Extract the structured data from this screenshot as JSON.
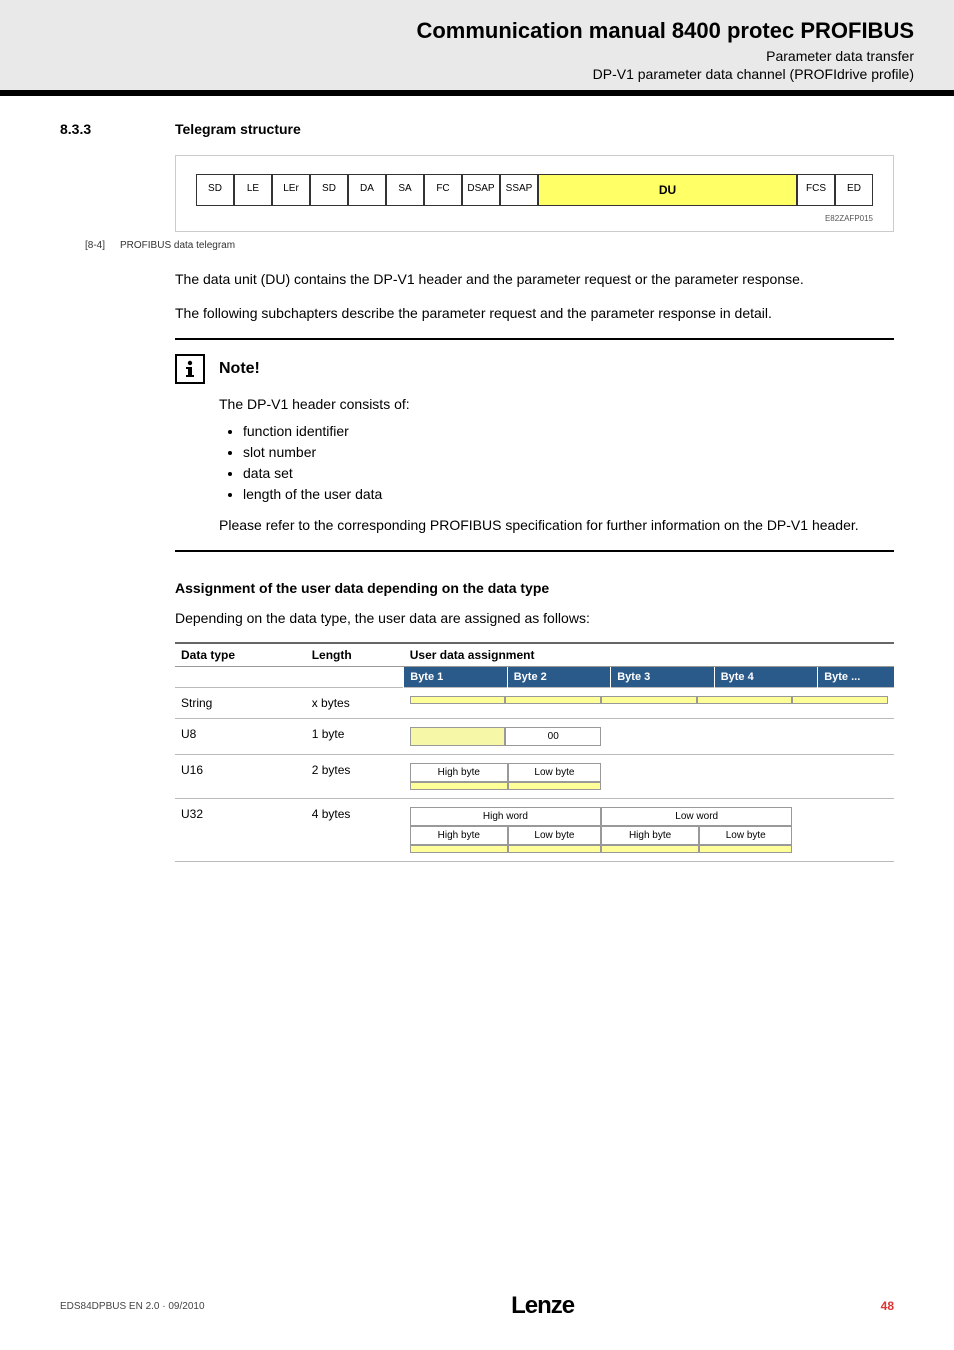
{
  "header": {
    "title": "Communication manual 8400 protec PROFIBUS",
    "sub1": "Parameter data transfer",
    "sub2": "DP-V1 parameter data channel (PROFIdrive profile)"
  },
  "section": {
    "num": "8.3.3",
    "title": "Telegram structure"
  },
  "telegram": {
    "cells": [
      "SD",
      "LE",
      "LEr",
      "SD",
      "DA",
      "SA",
      "FC",
      "DSAP",
      "SSAP"
    ],
    "du": "DU",
    "tail": [
      "FCS",
      "ED"
    ],
    "code": "E82ZAFP015"
  },
  "caption": {
    "num": "[8-4]",
    "text": "PROFIBUS data telegram"
  },
  "para1": "The data unit (DU) contains the DP-V1 header and the parameter request or the parameter response.",
  "para2": "The following subchapters describe the parameter request and the parameter response in detail.",
  "note": {
    "title": "Note!",
    "intro": "The DP-V1 header consists of:",
    "items": [
      "function identifier",
      "slot number",
      "data set",
      "length of the user data"
    ],
    "outro": "Please refer to the corresponding PROFIBUS specification for further information on the DP-V1 header."
  },
  "assign": {
    "heading": "Assignment of the user data depending on the data type",
    "intro": "Depending on the data type, the user data are assigned as follows:",
    "cols": {
      "c1": "Data type",
      "c2": "Length",
      "c3": "User data assignment",
      "b1": "Byte 1",
      "b2": "Byte 2",
      "b3": "Byte 3",
      "b4": "Byte 4",
      "b5": "Byte ..."
    },
    "rows": {
      "string": {
        "dt": "String",
        "len": "x bytes"
      },
      "u8": {
        "dt": "U8",
        "len": "1 byte",
        "b2": "00"
      },
      "u16": {
        "dt": "U16",
        "len": "2 bytes",
        "hb": "High byte",
        "lb": "Low byte"
      },
      "u32": {
        "dt": "U32",
        "len": "4 bytes",
        "hw": "High word",
        "lw": "Low word",
        "hb": "High byte",
        "lb": "Low byte"
      }
    }
  },
  "footer": {
    "doc": "EDS84DPBUS EN 2.0 · 09/2010",
    "logo": "Lenze",
    "page": "48"
  }
}
